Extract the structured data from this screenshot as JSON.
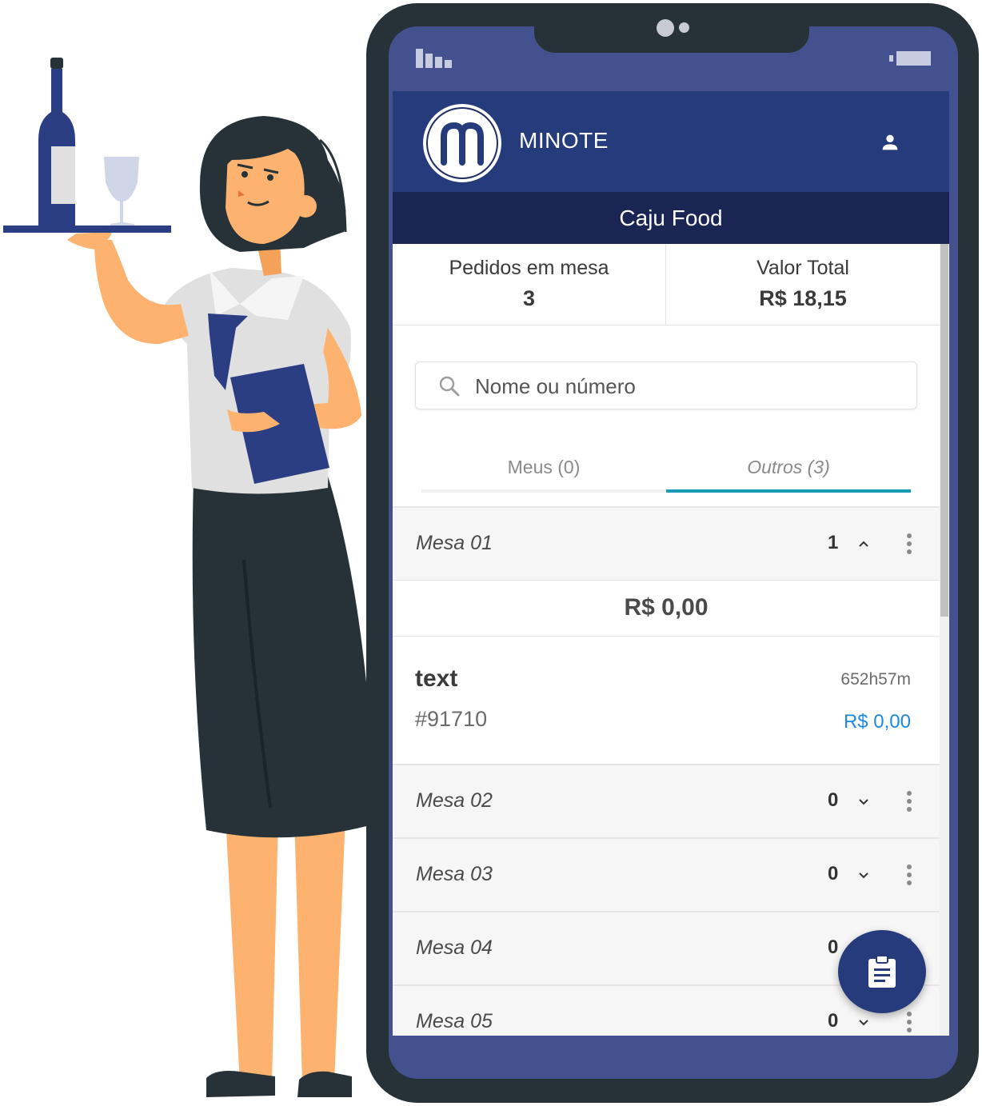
{
  "app": {
    "name": "MINOTE",
    "restaurant": "Caju Food"
  },
  "stats": {
    "orders_label": "Pedidos em mesa",
    "orders_value": "3",
    "total_label": "Valor Total",
    "total_value": "R$ 18,15"
  },
  "search": {
    "placeholder": "Nome ou número"
  },
  "tabs": [
    {
      "label": "Meus (0)"
    },
    {
      "label": "Outros (3)"
    }
  ],
  "tables": [
    {
      "name": "Mesa 01",
      "count": "1",
      "expanded": true,
      "total": "R$ 0,00",
      "orders": [
        {
          "name": "text",
          "id": "#91710",
          "time": "652h57m",
          "price": "R$ 0,00"
        }
      ]
    },
    {
      "name": "Mesa 02",
      "count": "0",
      "expanded": false
    },
    {
      "name": "Mesa 03",
      "count": "0",
      "expanded": false
    },
    {
      "name": "Mesa 04",
      "count": "0",
      "expanded": false
    },
    {
      "name": "Mesa 05",
      "count": "0",
      "expanded": false
    }
  ],
  "icons": {
    "user": "user-icon",
    "search": "search-icon",
    "chevron_up": "chevron-up-icon",
    "chevron_down": "chevron-down-icon",
    "more": "more-vert-icon",
    "fab": "clipboard-icon"
  },
  "colors": {
    "header": "#263b7b",
    "subheader": "#1b2553",
    "tab_active": "#1a9bb5",
    "price": "#1e88e5",
    "phone_frame": "#263238"
  }
}
